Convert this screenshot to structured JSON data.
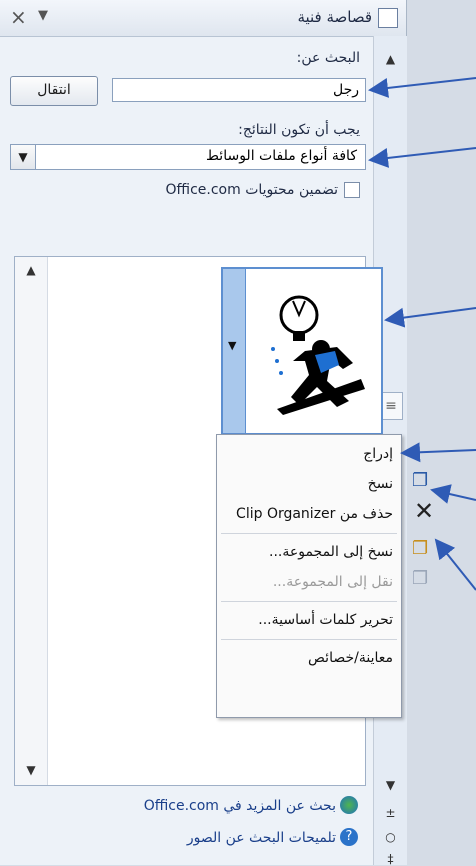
{
  "pane": {
    "title": "قصاصة فنية"
  },
  "search": {
    "label": "البحث عن:",
    "value": "رجل",
    "go_label": "انتقال"
  },
  "results_filter": {
    "label": "يجب أن تكون النتائج:",
    "selected": "كافة أنواع ملفات الوسائط"
  },
  "officecom": {
    "label": "تضمين محتويات Office.com",
    "checked": false
  },
  "context_menu": {
    "items": [
      {
        "label": "إدراج",
        "enabled": true
      },
      {
        "label": "نسخ",
        "enabled": true
      },
      {
        "label": "حذف من Clip Organizer",
        "enabled": true
      },
      {
        "label": "نسخ إلى المجموعة...",
        "enabled": true
      },
      {
        "label": "نقل إلى المجموعة...",
        "enabled": false
      },
      {
        "label": "تحرير كلمات أساسية...",
        "enabled": true
      },
      {
        "label": "معاينة/خصائص",
        "enabled": true
      }
    ]
  },
  "footer": {
    "more_link": "بحث عن المزيد في Office.com",
    "tips_link": "تلميحات البحث عن الصور"
  },
  "icons": [
    "close-icon",
    "menu-arrow-icon",
    "clipart-pane-icon",
    "copy-icon",
    "delete-icon",
    "copy-to-collection-icon",
    "move-to-collection-icon",
    "office-globe-icon",
    "help-icon"
  ],
  "colors": {
    "accent": "#2f5bb5",
    "thumb_border": "#5d8fd0",
    "pane_bg": "#edf2f8"
  }
}
